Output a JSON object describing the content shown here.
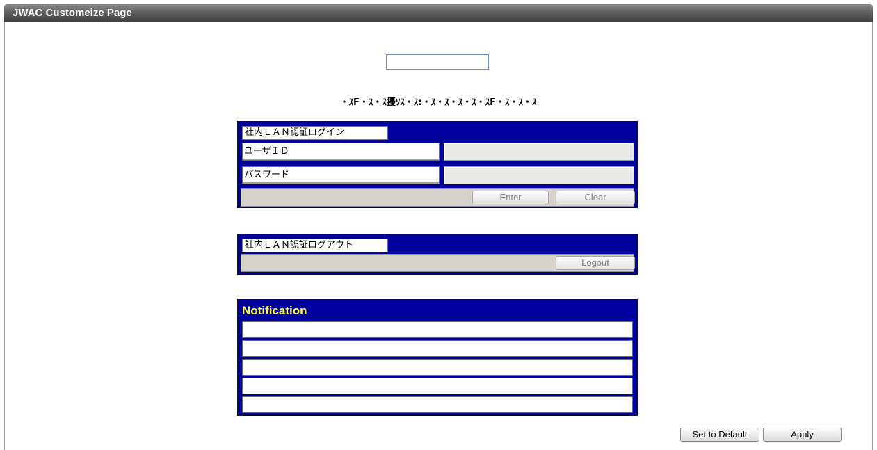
{
  "window": {
    "title": "JWAC Customeize Page"
  },
  "page_title_input": {
    "value": ""
  },
  "garbled_heading": "・ｽF・ｽ・ｽ擾ｿｽ・ｽ:・ｽ・ｽ・ｽ・ｽ・ｽF・ｽ・ｽ・ｽ",
  "login_panel": {
    "header": "社内ＬＡＮ認証ログイン",
    "user_label": "ユーザＩＤ",
    "user_value": "",
    "password_label": "パスワード",
    "password_value": "",
    "enter_label": "Enter",
    "clear_label": "Clear"
  },
  "logout_panel": {
    "header": "社内ＬＡＮ認証ログアウト",
    "logout_label": "Logout"
  },
  "notification_panel": {
    "title": "Notification",
    "lines": [
      "",
      "",
      "",
      "",
      ""
    ]
  },
  "actions": {
    "set_default_label": "Set to Default",
    "apply_label": "Apply"
  },
  "colors": {
    "panel_bg": "#00009c",
    "notification_title": "#ffff33",
    "titlebar": "#4a4a4a"
  }
}
